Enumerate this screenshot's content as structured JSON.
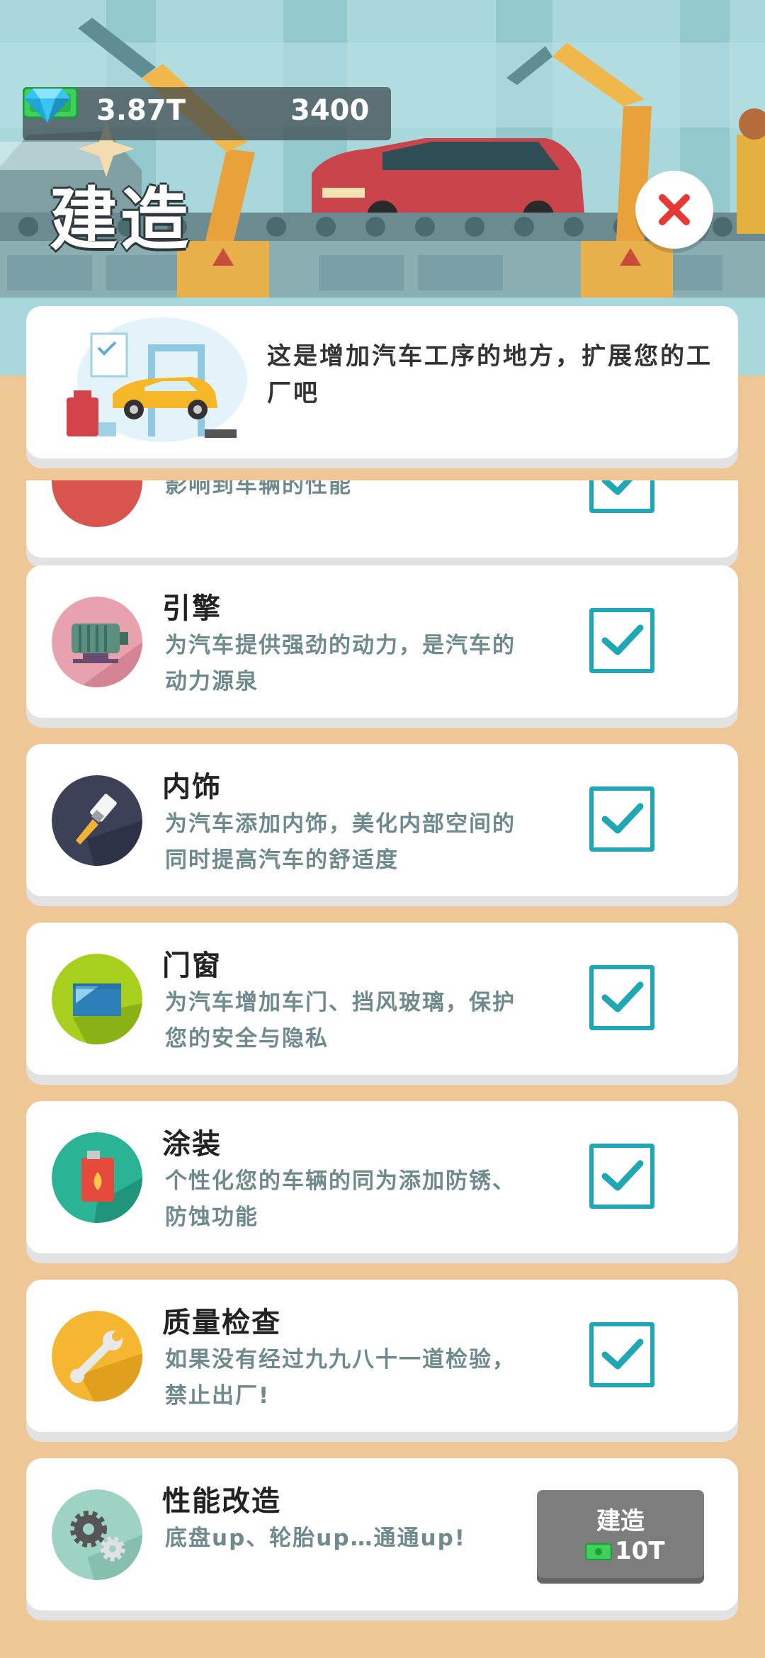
{
  "header": {
    "cash": "3.87T",
    "gems": "3400",
    "title": "建造",
    "cash_icon": "cash-icon",
    "gem_icon": "diamond-icon",
    "close_icon": "close-icon"
  },
  "intro": {
    "text": "这是增加汽车工序的地方，扩展您的工厂吧"
  },
  "items": [
    {
      "name": "",
      "desc": "影响到车辆的性能",
      "icon": "partial-icon",
      "built": true
    },
    {
      "name": "引擎",
      "desc": "为汽车提供强劲的动力，是汽车的动力源泉",
      "icon": "engine-icon",
      "built": true
    },
    {
      "name": "内饰",
      "desc": "为汽车添加内饰，美化内部空间的同时提高汽车的舒适度",
      "icon": "paintbrush-icon",
      "built": true
    },
    {
      "name": "门窗",
      "desc": "为汽车增加车门、挡风玻璃，保护您的安全与隐私",
      "icon": "window-icon",
      "built": true
    },
    {
      "name": "涂装",
      "desc": "个性化您的车辆的同为添加防锈、防蚀功能",
      "icon": "paint-can-icon",
      "built": true
    },
    {
      "name": "质量检查",
      "desc": "如果没有经过九九八十一道检验，禁止出厂!",
      "icon": "wrench-icon",
      "built": true
    },
    {
      "name": "性能改造",
      "desc": "底盘up、轮胎up…通通up!",
      "icon": "gears-icon",
      "built": false,
      "build_label": "建造",
      "build_cost": "10T"
    }
  ],
  "colors": {
    "background": "#efc797",
    "checkbox": "#1fa7b5",
    "desc_text": "#6e8a8d",
    "build_button": "#7d7d7d",
    "close_x": "#e53935"
  }
}
